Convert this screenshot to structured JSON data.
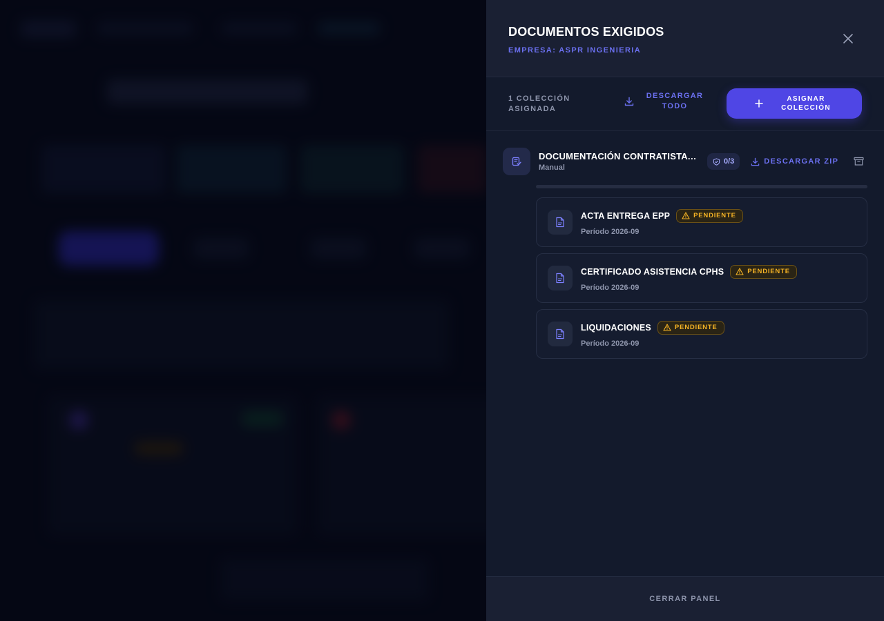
{
  "panel": {
    "title": "DOCUMENTOS EXIGIDOS",
    "subtitle": "EMPRESA: ASPR INGENIERIA",
    "close_icon": "close-icon"
  },
  "toolbar": {
    "assigned_count": "1 COLECCIÓN ASIGNADA",
    "download_all_label": "DESCARGAR TODO",
    "assign_label": "ASIGNAR COLECCIÓN"
  },
  "collection": {
    "title": "DOCUMENTACIÓN CONTRATISTA [D...",
    "type": "Manual",
    "progress": "0/3",
    "progress_fraction": 0,
    "zip_label": "DESCARGAR ZIP",
    "documents": [
      {
        "name": "ACTA ENTREGA EPP",
        "status": "PENDIENTE",
        "period": "Período 2026-09"
      },
      {
        "name": "CERTIFICADO ASISTENCIA CPHS",
        "status": "PENDIENTE",
        "period": "Período 2026-09"
      },
      {
        "name": "LIQUIDACIONES",
        "status": "PENDIENTE",
        "period": "Período 2026-09"
      }
    ]
  },
  "footer": {
    "close_label": "CERRAR PANEL"
  },
  "colors": {
    "accent": "#4f46e5",
    "accent_text": "#6b70f0",
    "warning": "#f5b325",
    "panel_bg": "#131a2c"
  }
}
